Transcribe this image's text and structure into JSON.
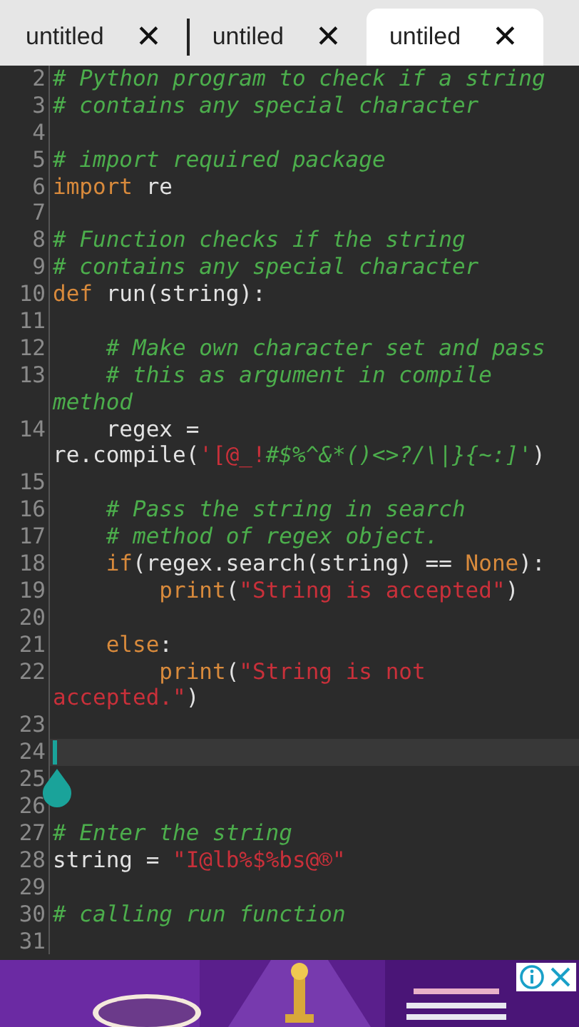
{
  "tabs": [
    {
      "label": "untitled",
      "close": "✕",
      "selected": false
    },
    {
      "label": "untiled",
      "close": "✕",
      "selected": false
    },
    {
      "label": "untiled",
      "close": "✕",
      "selected": true
    }
  ],
  "editor": {
    "rows": [
      {
        "number": "2",
        "current": false,
        "tokens": [
          {
            "kind": "comment",
            "text": "# Python program to check if a string"
          }
        ]
      },
      {
        "number": "3",
        "current": false,
        "tokens": [
          {
            "kind": "comment",
            "text": "# contains any special character"
          }
        ]
      },
      {
        "number": "4",
        "current": false,
        "tokens": []
      },
      {
        "number": "5",
        "current": false,
        "tokens": [
          {
            "kind": "comment",
            "text": "# import required package"
          }
        ]
      },
      {
        "number": "6",
        "current": false,
        "tokens": [
          {
            "kind": "keyword",
            "text": "import"
          },
          {
            "kind": "plain",
            "text": " re"
          }
        ]
      },
      {
        "number": "7",
        "current": false,
        "tokens": []
      },
      {
        "number": "8",
        "current": false,
        "tokens": [
          {
            "kind": "comment",
            "text": "# Function checks if the string"
          }
        ]
      },
      {
        "number": "9",
        "current": false,
        "tokens": [
          {
            "kind": "comment",
            "text": "# contains any special character"
          }
        ]
      },
      {
        "number": "10",
        "current": false,
        "tokens": [
          {
            "kind": "keyword",
            "text": "def"
          },
          {
            "kind": "plain",
            "text": " run(string):"
          }
        ]
      },
      {
        "number": "11",
        "current": false,
        "tokens": []
      },
      {
        "number": "12",
        "current": false,
        "tokens": [
          {
            "kind": "comment",
            "text": "    # Make own character set and pass"
          }
        ]
      },
      {
        "number": "13",
        "current": false,
        "tokens": [
          {
            "kind": "comment",
            "text": "    # this as argument in compile"
          }
        ]
      },
      {
        "current": false,
        "tokens": [
          {
            "kind": "comment",
            "text": "method"
          }
        ]
      },
      {
        "number": "14",
        "current": false,
        "tokens": [
          {
            "kind": "plain",
            "text": "    regex ="
          }
        ]
      },
      {
        "current": false,
        "tokens": [
          {
            "kind": "plain",
            "text": "re.compile("
          },
          {
            "kind": "string",
            "text": "'[@_!"
          },
          {
            "kind": "comment",
            "text": "#$%^&*()<>?/\\|}{~:]'"
          },
          {
            "kind": "plain",
            "text": ")"
          }
        ]
      },
      {
        "number": "15",
        "current": false,
        "tokens": []
      },
      {
        "number": "16",
        "current": false,
        "tokens": [
          {
            "kind": "comment",
            "text": "    # Pass the string in search"
          }
        ]
      },
      {
        "number": "17",
        "current": false,
        "tokens": [
          {
            "kind": "comment",
            "text": "    # method of regex object."
          }
        ]
      },
      {
        "number": "18",
        "current": false,
        "tokens": [
          {
            "kind": "keyword",
            "text": "    if"
          },
          {
            "kind": "plain",
            "text": "(regex.search(string) == "
          },
          {
            "kind": "keyword",
            "text": "None"
          },
          {
            "kind": "plain",
            "text": "):"
          }
        ]
      },
      {
        "number": "19",
        "current": false,
        "tokens": [
          {
            "kind": "keyword",
            "text": "        print"
          },
          {
            "kind": "plain",
            "text": "("
          },
          {
            "kind": "string",
            "text": "\"String is accepted\""
          },
          {
            "kind": "plain",
            "text": ")"
          }
        ]
      },
      {
        "number": "20",
        "current": false,
        "tokens": []
      },
      {
        "number": "21",
        "current": false,
        "tokens": [
          {
            "kind": "keyword",
            "text": "    else"
          },
          {
            "kind": "plain",
            "text": ":"
          }
        ]
      },
      {
        "number": "22",
        "current": false,
        "tokens": [
          {
            "kind": "keyword",
            "text": "        print"
          },
          {
            "kind": "plain",
            "text": "("
          },
          {
            "kind": "string",
            "text": "\"String is not"
          }
        ]
      },
      {
        "current": false,
        "tokens": [
          {
            "kind": "string",
            "text": "accepted.\""
          },
          {
            "kind": "plain",
            "text": ")"
          }
        ]
      },
      {
        "number": "23",
        "current": false,
        "tokens": []
      },
      {
        "number": "24",
        "current": true,
        "tokens": []
      },
      {
        "number": "25",
        "current": false,
        "tokens": []
      },
      {
        "number": "26",
        "current": false,
        "tokens": []
      },
      {
        "number": "27",
        "current": false,
        "tokens": [
          {
            "kind": "comment",
            "text": "# Enter the string"
          }
        ]
      },
      {
        "number": "28",
        "current": false,
        "tokens": [
          {
            "kind": "plain",
            "text": "string = "
          },
          {
            "kind": "string",
            "text": "\"I@lb%$%bs@®\""
          }
        ]
      },
      {
        "number": "29",
        "current": false,
        "tokens": []
      },
      {
        "number": "30",
        "current": false,
        "tokens": [
          {
            "kind": "comment",
            "text": "# calling run function"
          }
        ]
      },
      {
        "number": "31",
        "current": false,
        "tokens": []
      }
    ]
  }
}
